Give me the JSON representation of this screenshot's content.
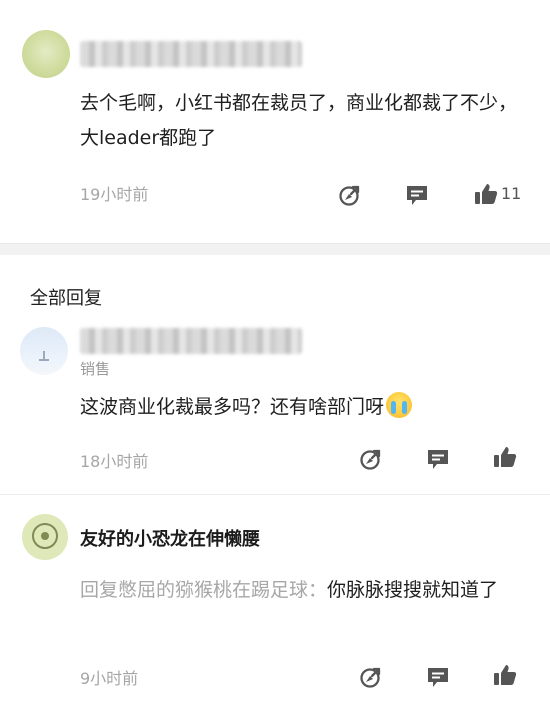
{
  "comment": {
    "text": "去个毛啊，小红书都在裁员了，商业化都裁了不少，大leader都跑了",
    "time": "19小时前",
    "like_count": "11"
  },
  "replies_section": {
    "title": "全部回复"
  },
  "reply1": {
    "role": "销售",
    "text": "这波商业化裁最多吗？还有啥部门呀",
    "emoji": "crying-face-emoji",
    "time": "18小时前"
  },
  "reply2": {
    "username": "友好的小恐龙在伸懒腰",
    "reply_prefix": "回复憋屈的猕猴桃在踢足球：",
    "text": "你脉脉搜搜就知道了",
    "time": "9小时前"
  },
  "icons": {
    "share": "share-icon",
    "comment": "comment-icon",
    "like": "thumbs-up-icon"
  },
  "colors": {
    "secondary_text": "#a6a6a6",
    "icon": "#555555",
    "divider": "#f2f2f2"
  }
}
